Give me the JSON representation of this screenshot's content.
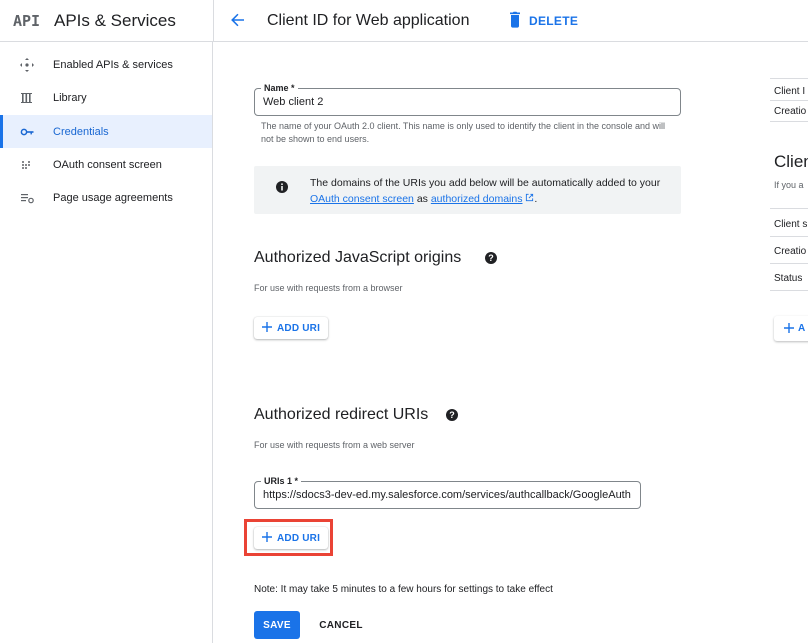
{
  "header": {
    "logo": "API",
    "app_title": "APIs & Services",
    "page_title": "Client ID for Web application",
    "delete_label": "DELETE"
  },
  "sidebar": {
    "items": [
      {
        "label": "Enabled APIs & services",
        "icon": "enabled-apis-icon"
      },
      {
        "label": "Library",
        "icon": "library-icon"
      },
      {
        "label": "Credentials",
        "icon": "key-icon",
        "active": true
      },
      {
        "label": "OAuth consent screen",
        "icon": "consent-screen-icon"
      },
      {
        "label": "Page usage agreements",
        "icon": "settings-list-icon"
      }
    ]
  },
  "form": {
    "name_label": "Name *",
    "name_value": "Web client 2",
    "name_hint": "The name of your OAuth 2.0 client. This name is only used to identify the client in the console and will not be shown to end users.",
    "info": {
      "text_before": "The domains of the URIs you add below will be automatically added to your ",
      "link1": "OAuth consent screen",
      "text_middle": " as ",
      "link2": "authorized domains"
    },
    "js_origins": {
      "title": "Authorized JavaScript origins",
      "subtitle": "For use with requests from a browser",
      "add_label": "ADD URI"
    },
    "redirect_uris": {
      "title": "Authorized redirect URIs",
      "subtitle": "For use with requests from a web server",
      "uri_label": "URIs 1 *",
      "uri_value": "https://sdocs3-dev-ed.my.salesforce.com/services/authcallback/GoogleAuth",
      "add_label": "ADD URI"
    },
    "note": "Note: It may take 5 minutes to a few hours for settings to take effect",
    "save_label": "SAVE",
    "cancel_label": "CANCEL"
  },
  "right_panel": {
    "client_id": "Client I",
    "creation": "Creatio",
    "section_title": "Clien",
    "section_sub": "If you a",
    "client_s": "Client s",
    "creation2": "Creatio",
    "status": "Status",
    "add_label": "A"
  },
  "colors": {
    "accent": "#1a73e8",
    "active_bg": "#e8f0fe",
    "highlight": "#ea4335"
  }
}
